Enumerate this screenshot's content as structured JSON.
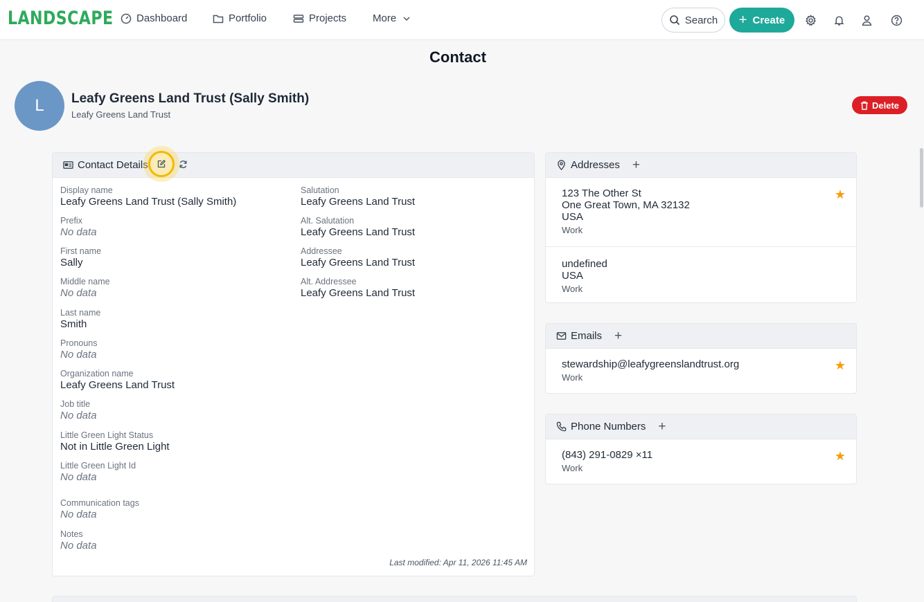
{
  "app": {
    "logo": "LANDSCAPE"
  },
  "nav": {
    "dashboard": "Dashboard",
    "portfolio": "Portfolio",
    "projects": "Projects",
    "more": "More",
    "search": "Search",
    "create": "Create"
  },
  "page": {
    "title": "Contact"
  },
  "contact": {
    "initial": "L",
    "name": "Leafy Greens Land Trust (Sally Smith)",
    "org": "Leafy Greens Land Trust",
    "delete": "Delete"
  },
  "details": {
    "title": "Contact Details",
    "left": [
      {
        "label": "Display name",
        "value": "Leafy Greens Land Trust (Sally Smith)",
        "empty": false
      },
      {
        "label": "Prefix",
        "value": "No data",
        "empty": true
      },
      {
        "label": "First name",
        "value": "Sally",
        "empty": false
      },
      {
        "label": "Middle name",
        "value": "No data",
        "empty": true
      },
      {
        "label": "Last name",
        "value": "Smith",
        "empty": false
      },
      {
        "label": "Pronouns",
        "value": "No data",
        "empty": true
      },
      {
        "label": "Organization name",
        "value": "Leafy Greens Land Trust",
        "empty": false
      },
      {
        "label": "Job title",
        "value": "No data",
        "empty": true
      },
      {
        "label": "Little Green Light Status",
        "value": "Not in Little Green Light",
        "empty": false
      },
      {
        "label": "Little Green Light Id",
        "value": "No data",
        "empty": true
      },
      {
        "label": "Communication tags",
        "value": "No data",
        "empty": true
      },
      {
        "label": "Notes",
        "value": "No data",
        "empty": true
      }
    ],
    "right": [
      {
        "label": "Salutation",
        "value": "Leafy Greens Land Trust"
      },
      {
        "label": "Alt. Salutation",
        "value": "Leafy Greens Land Trust"
      },
      {
        "label": "Addressee",
        "value": "Leafy Greens Land Trust"
      },
      {
        "label": "Alt. Addressee",
        "value": "Leafy Greens Land Trust"
      }
    ],
    "last_modified": "Last modified: Apr 11, 2026 11:45 AM"
  },
  "addresses": {
    "title": "Addresses",
    "items": [
      {
        "lines": [
          "123 The Other St",
          "One Great Town, MA 32132",
          "USA"
        ],
        "type": "Work",
        "primary": true
      },
      {
        "lines": [
          "undefined",
          "USA"
        ],
        "type": "Work",
        "primary": false
      }
    ]
  },
  "emails": {
    "title": "Emails",
    "items": [
      {
        "value": "stewardship@leafygreenslandtrust.org",
        "type": "Work",
        "primary": true
      }
    ]
  },
  "phones": {
    "title": "Phone Numbers",
    "items": [
      {
        "value": "(843) 291-0829 ×11",
        "type": "Work",
        "primary": true
      }
    ]
  },
  "colors": {
    "accent": "#1ea99a",
    "logo": "#2eaa5b",
    "danger": "#dc1f26",
    "star": "#f59e0b",
    "avatar": "#6b97c6"
  }
}
